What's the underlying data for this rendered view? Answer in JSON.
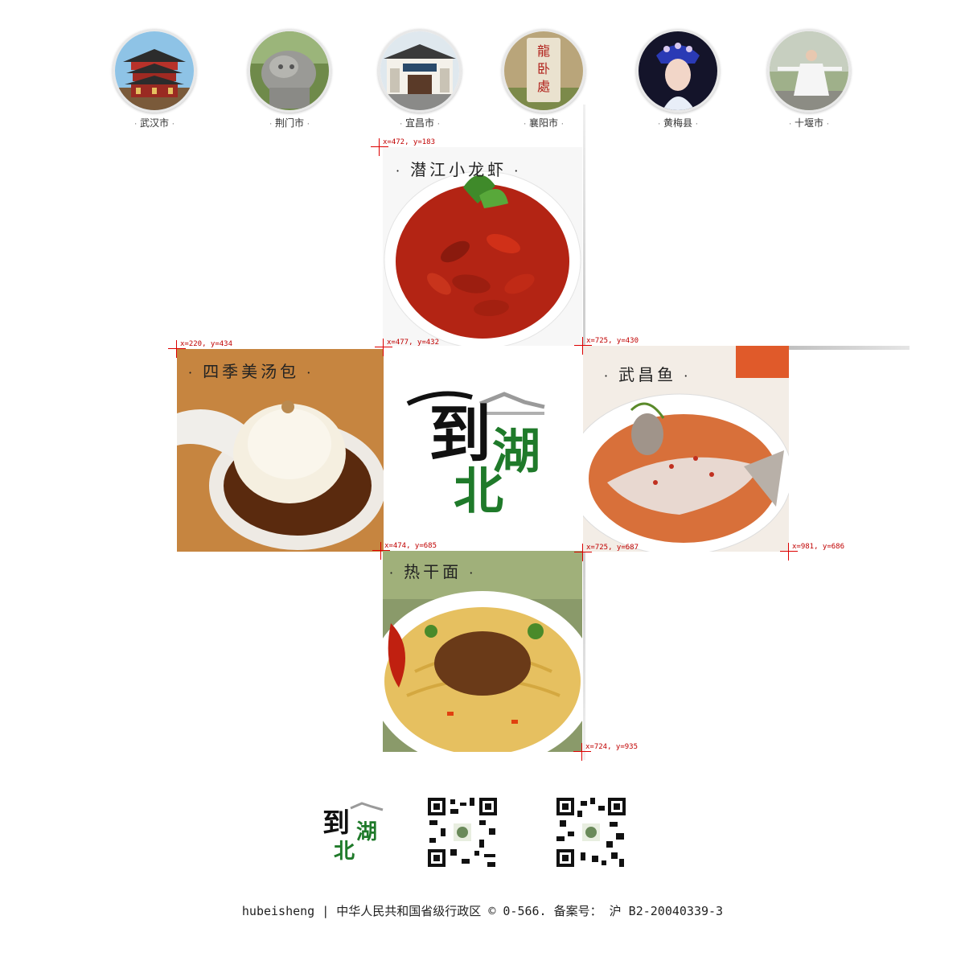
{
  "cities": [
    {
      "name": "武汉市",
      "icon": "yellow-crane-tower-image"
    },
    {
      "name": "荆门市",
      "icon": "stone-lion-image"
    },
    {
      "name": "宜昌市",
      "icon": "ancient-gate-image"
    },
    {
      "name": "襄阳市",
      "icon": "wolong-stele-image"
    },
    {
      "name": "黄梅县",
      "icon": "opera-performer-image"
    },
    {
      "name": "十堰市",
      "icon": "taichi-performer-image"
    }
  ],
  "foods": {
    "crayfish": "潜江小龙虾",
    "soup_bun": "四季美汤包",
    "fish": "武昌鱼",
    "noodles": "热干面"
  },
  "logo": {
    "text": "到湖北"
  },
  "markers": [
    "x=472, y=183",
    "x=477, y=432",
    "x=220, y=434",
    "x=725, y=430",
    "x=474, y=685",
    "x=725, y=687",
    "x=981, y=686",
    "x=724, y=935"
  ],
  "footer": {
    "copyright": "hubeisheng | 中华人民共和国省级行政区 © 0-566. 备案号： 沪 B2-20040339-3"
  }
}
